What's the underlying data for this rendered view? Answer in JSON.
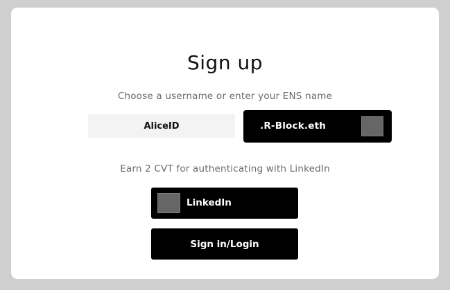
{
  "signup": {
    "title": "Sign up",
    "subtitle": "Choose a username or enter your ENS name",
    "username_value": "AliceID",
    "ens_suffix": ".R-Block.eth",
    "ens_icon": "ens-logo-placeholder",
    "earn_text": "Earn 2 CVT for authenticating with LinkedIn",
    "linkedin_label": "LinkedIn",
    "linkedin_icon": "linkedin-logo-placeholder",
    "login_label": "Sign in/Login"
  },
  "colors": {
    "background": "#cfcfcf",
    "card": "#ffffff",
    "button": "#000000",
    "input": "#f3f3f3",
    "icon_placeholder": "#666666"
  }
}
